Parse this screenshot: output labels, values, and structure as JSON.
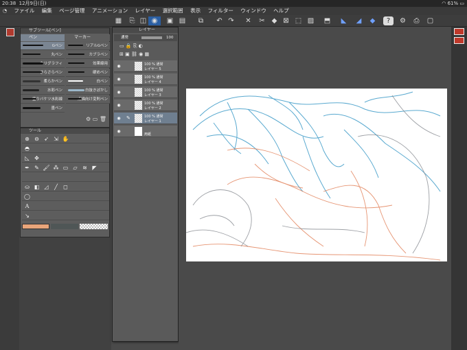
{
  "status": {
    "time": "20:38",
    "date": "12月9日(日)",
    "battery": "61%"
  },
  "menu": {
    "items": [
      "ファイル",
      "編集",
      "ページ管理",
      "アニメーション",
      "レイヤー",
      "選択範囲",
      "表示",
      "フィルター",
      "ウィンドウ",
      "ヘルプ"
    ]
  },
  "subtool_panel": {
    "title": "サブツール[ペン]",
    "categories": [
      "ペン",
      "マーカー"
    ],
    "brushes": [
      [
        "Gペン",
        "リアルGペン"
      ],
      [
        "丸ペン",
        "カブラペン"
      ],
      [
        "カリグラフィ",
        "効果線用"
      ],
      [
        "さらさらペン",
        "硬めペン"
      ],
      [
        "柔らかペン",
        "白ペン"
      ],
      [
        "水彩ペン",
        "白抜きぼかし"
      ],
      [
        "塗りバケツ水彩線",
        "点描向け変則ペン"
      ],
      [
        "墨ペン",
        ""
      ]
    ]
  },
  "tool_panel": {
    "title": "ツール"
  },
  "layer_panel": {
    "title": "レイヤー",
    "blend_mode": "通常",
    "opacity": "100",
    "layers": [
      {
        "opacity": "100 % 通常",
        "name": "レイヤー 5"
      },
      {
        "opacity": "100 % 通常",
        "name": "レイヤー 4"
      },
      {
        "opacity": "100 % 通常",
        "name": "レイヤー 3"
      },
      {
        "opacity": "100 % 通常",
        "name": "レイヤー 2"
      },
      {
        "opacity": "100 % 通常",
        "name": "レイヤー 1"
      },
      {
        "opacity": "",
        "name": "用紙"
      }
    ]
  },
  "colors": {
    "main": "#e9a57a",
    "sub": "#4f5656",
    "accent": "#2b5fa3"
  }
}
